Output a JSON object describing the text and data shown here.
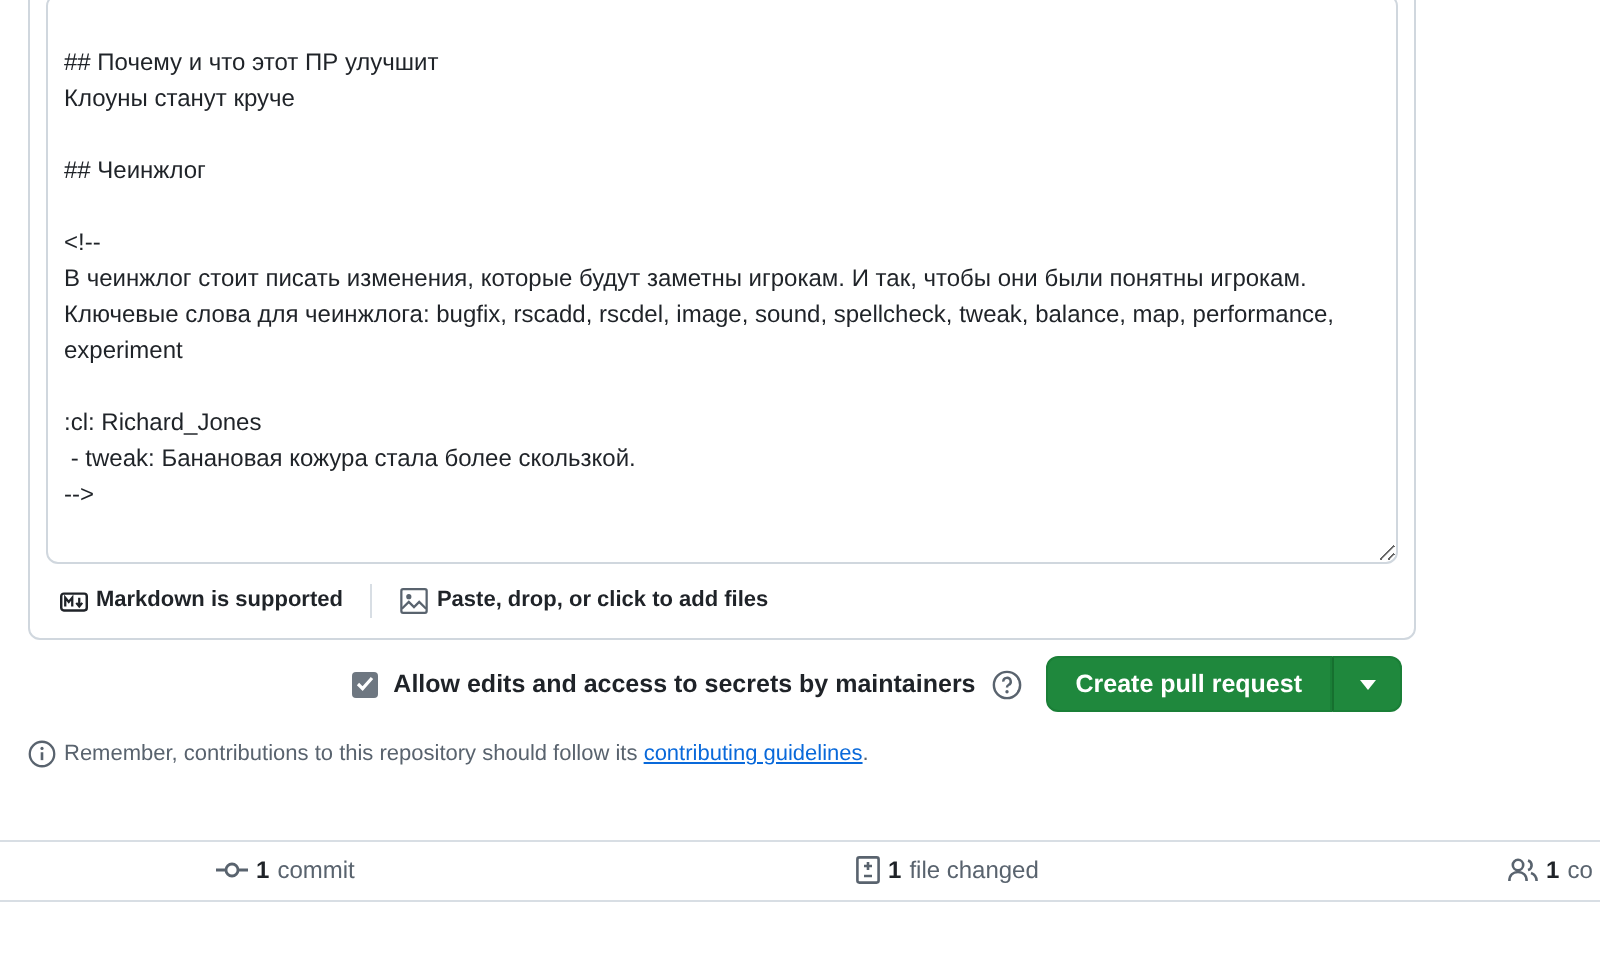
{
  "description": {
    "blocks": [
      [
        "## Почему и что этот ПР улучшит",
        "Клоуны станут круче"
      ],
      [
        "## Чеинжлог"
      ],
      [
        "<!--",
        "В чеинжлог стоит писать изменения, которые будут заметны игрокам. И так, чтобы они были понятны игрокам.",
        "Ключевые слова для чеинжлога: bugfix, rscadd, rscdel, image, sound, spellcheck, tweak, balance, map, performance, experiment"
      ],
      [
        ":cl: Richard_Jones",
        " - tweak: Банановая кожура стала более скользкой.",
        "-->"
      ]
    ]
  },
  "editor_footer": [
    {
      "kind": "markdown",
      "label": "Markdown is supported"
    },
    {
      "kind": "attach",
      "label": "Paste, drop, or click to add files"
    }
  ],
  "allow_edits": {
    "label": "Allow edits and access to secrets by maintainers",
    "checked": true
  },
  "create_button": {
    "label": "Create pull request"
  },
  "notice": {
    "text": "Remember, contributions to this repository should follow its ",
    "link": "contributing guidelines",
    "end": "."
  },
  "summary": [
    {
      "kind": "commit",
      "count": "1",
      "label": "commit"
    },
    {
      "kind": "files",
      "count": "1",
      "label": "file changed"
    },
    {
      "kind": "contributors",
      "count": "1",
      "label": "co"
    }
  ]
}
